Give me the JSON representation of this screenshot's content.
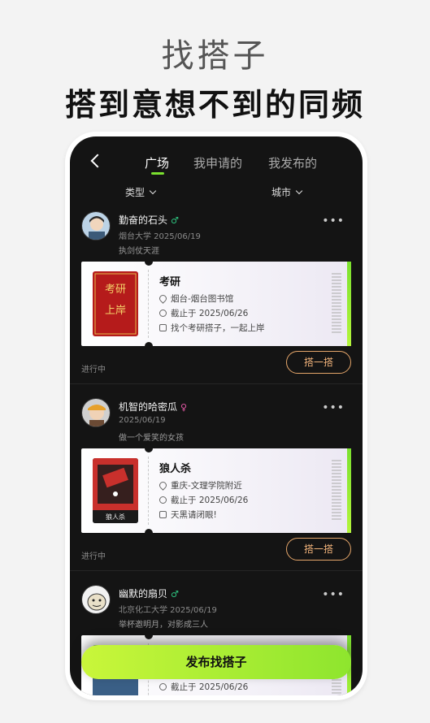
{
  "hero": {
    "title": "找搭子",
    "subtitle": "搭到意想不到的同频"
  },
  "nav": {
    "tabs": [
      {
        "label": "广场",
        "active": true
      },
      {
        "label": "我申请的",
        "active": false
      },
      {
        "label": "我发布的",
        "active": false
      }
    ]
  },
  "filters": {
    "type_label": "类型",
    "city_label": "城市"
  },
  "posts": [
    {
      "name": "勤奋的石头",
      "gender": "♂",
      "gender_color": "#2ec27e",
      "meta": "烟台大学 2025/06/19",
      "bio": "执剑仗天涯",
      "cover_text": "考研上岸",
      "activity_title": "考研",
      "location": "烟台-烟台图书馆",
      "deadline": "截止于 2025/06/26",
      "note": "找个考研搭子，一起上岸",
      "status": "进行中",
      "join_label": "搭一搭"
    },
    {
      "name": "机智的哈密瓜",
      "gender": "♀",
      "gender_color": "#e85aa8",
      "meta": "2025/06/19",
      "bio": "做一个爱笑的女孩",
      "cover_text": "狼人杀",
      "activity_title": "狼人杀",
      "location": "重庆-文理学院附近",
      "deadline": "截止于 2025/06/26",
      "note": "天黑请闭眼!",
      "status": "进行中",
      "join_label": "搭一搭"
    },
    {
      "name": "幽默的扇贝",
      "gender": "♂",
      "gender_color": "#2ec27e",
      "meta": "北京化工大学 2025/06/19",
      "bio": "举杯邀明月，对影成三人",
      "deadline": "截止于 2025/06/26"
    }
  ],
  "publish_label": "发布找搭子",
  "more_label": "•••",
  "colors": {
    "accent": "#7be12f",
    "join_border": "#e5a66a",
    "background": "#141414"
  }
}
